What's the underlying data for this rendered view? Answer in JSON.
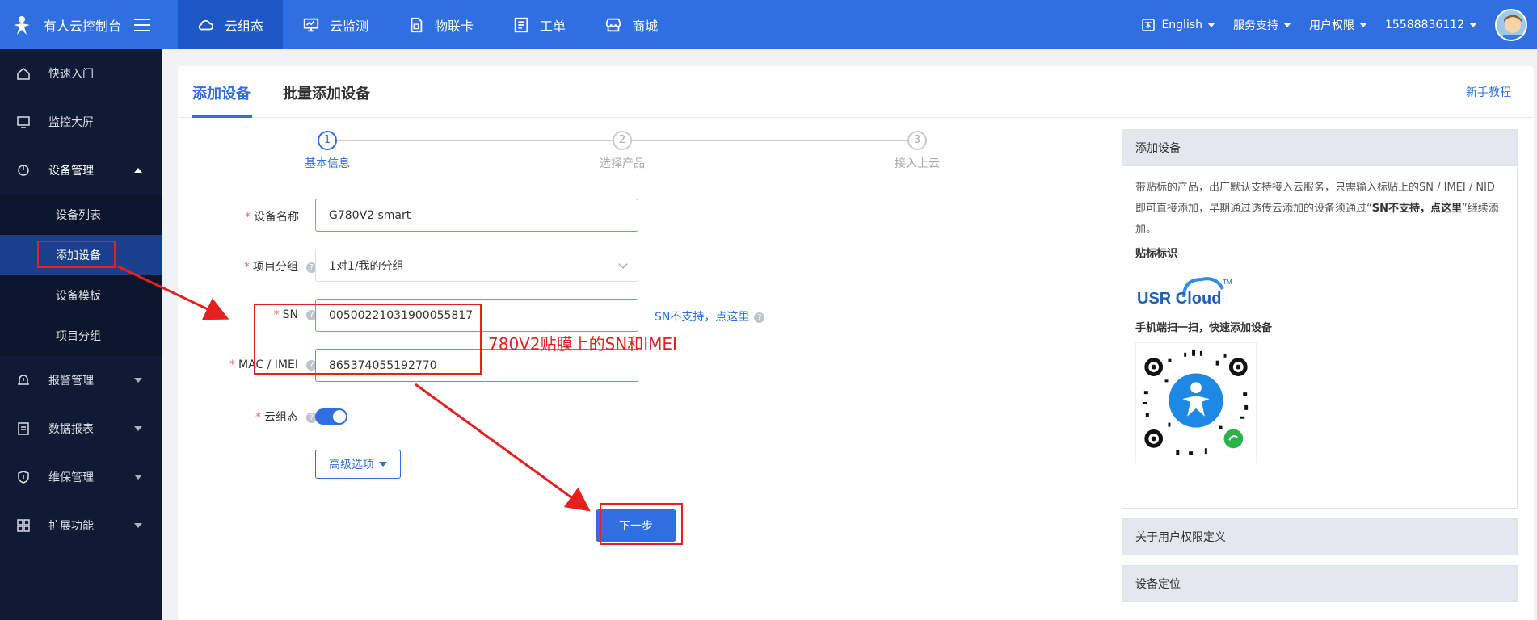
{
  "topbar": {
    "app_title": "有人云控制台",
    "tabs": [
      {
        "label": "云组态",
        "icon": "cloud-icon",
        "active": true
      },
      {
        "label": "云监测",
        "icon": "monitor-icon"
      },
      {
        "label": "物联卡",
        "icon": "sim-card-icon"
      },
      {
        "label": "工单",
        "icon": "work-order-icon"
      },
      {
        "label": "商城",
        "icon": "store-icon"
      }
    ],
    "language": "English",
    "service": "服务支持",
    "permission": "用户权限",
    "account": "15588836112"
  },
  "sidebar": {
    "items": [
      {
        "label": "快速入门",
        "icon": "home-icon"
      },
      {
        "label": "监控大屏",
        "icon": "screen-icon"
      },
      {
        "label": "设备管理",
        "icon": "device-icon",
        "expanded": true
      },
      {
        "label": "报警管理",
        "icon": "alarm-icon"
      },
      {
        "label": "数据报表",
        "icon": "report-icon"
      },
      {
        "label": "维保管理",
        "icon": "shield-icon"
      },
      {
        "label": "扩展功能",
        "icon": "extension-icon"
      }
    ],
    "sub_items": [
      "设备列表",
      "添加设备",
      "设备模板",
      "项目分组"
    ],
    "active_sub": "添加设备"
  },
  "main": {
    "tabs": [
      "添加设备",
      "批量添加设备"
    ],
    "active_tab": "添加设备",
    "tutorial_link": "新手教程",
    "steps": [
      {
        "num": "1",
        "label": "基本信息",
        "active": true
      },
      {
        "num": "2",
        "label": "选择产品"
      },
      {
        "num": "3",
        "label": "接入上云"
      }
    ],
    "form": {
      "device_name_label": "设备名称",
      "device_name_value": "G780V2 smart",
      "project_group_label": "项目分组",
      "project_group_value": "1对1/我的分组",
      "sn_label": "SN",
      "sn_value": "00500221031900055817",
      "sn_link": "SN不支持，点这里",
      "mac_label": "MAC / IMEI",
      "mac_value": "865374055192770",
      "cloud_config_label": "云组态",
      "cloud_config_on": true,
      "advanced_label": "高级选项",
      "next_label": "下一步"
    },
    "annotation": "780V2贴膜上的SN和IMEI"
  },
  "info_panel": {
    "header": "添加设备",
    "description_1": "带贴标的产品，出厂默认支持接入云服务，只需输入标贴上的SN / IMEI / NID 即可直接添加，早期通过透传云添加的设备须通过“",
    "description_bold": "SN不支持，点这里",
    "description_2": "”继续添加。",
    "label_title": "贴标标识",
    "logo_text": "USR Cloud",
    "logo_tm": "TM",
    "qr_title": "手机端扫一扫，快速添加设备",
    "section_2": "关于用户权限定义",
    "section_3": "设备定位"
  },
  "colors": {
    "primary": "#2f6fe0",
    "sidebar_bg": "#0f1b35",
    "annotation": "#e81f1f"
  }
}
